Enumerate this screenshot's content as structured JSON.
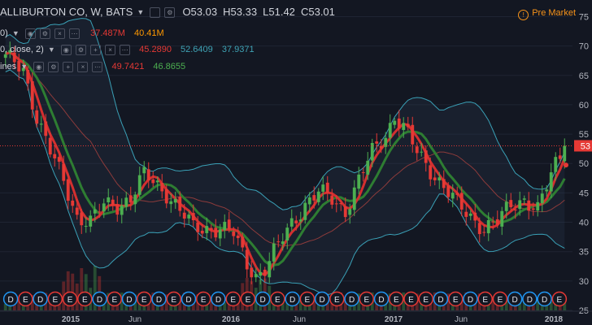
{
  "header": {
    "symbol_title": "ALLIBURTON CO, W, BATS",
    "ohlc": {
      "open": "O53.03",
      "high": "H53.33",
      "low": "L51.42",
      "close": "C53.01"
    },
    "market_status": "Pre Market"
  },
  "indicators": [
    {
      "label": "0)",
      "values": [
        "37.487M",
        "40.41M"
      ]
    },
    {
      "label": "0, close, 2)",
      "values": [
        "45.2890",
        "52.6409",
        "37.9371"
      ]
    },
    {
      "label": "ines",
      "values": [
        "49.7421",
        "46.8655"
      ]
    }
  ],
  "colors": {
    "background": "#131722",
    "up": "#4caf50",
    "down": "#e53935",
    "grid": "#1f2433",
    "band": "#3aa0b6",
    "fast_line": "#d32f2f",
    "slow_line": "#2e7d32",
    "price_line": "#e53935"
  },
  "chart_data": {
    "type": "candlestick",
    "price_axis_ticks": [
      "75",
      "70",
      "65",
      "60",
      "55",
      "50",
      "45",
      "40",
      "35",
      "30",
      "25"
    ],
    "ylim": [
      25,
      77
    ],
    "time_axis_labels": [
      "2015",
      "Jun",
      "2016",
      "Jun",
      "2017",
      "Jun",
      "2018"
    ],
    "last_price_label": "53",
    "last_price": 53.01,
    "anchor_points": [
      [
        0,
        68
      ],
      [
        4,
        66
      ],
      [
        7,
        58
      ],
      [
        10,
        52
      ],
      [
        13,
        47
      ],
      [
        16,
        41
      ],
      [
        19,
        40
      ],
      [
        22,
        43
      ],
      [
        25,
        43
      ],
      [
        28,
        44
      ],
      [
        31,
        48
      ],
      [
        33,
        47
      ],
      [
        36,
        45
      ],
      [
        39,
        42
      ],
      [
        42,
        39
      ],
      [
        45,
        39
      ],
      [
        48,
        39
      ],
      [
        51,
        38
      ],
      [
        54,
        33
      ],
      [
        56,
        31
      ],
      [
        58,
        32
      ],
      [
        61,
        36
      ],
      [
        64,
        40
      ],
      [
        67,
        43
      ],
      [
        70,
        45
      ],
      [
        73,
        44
      ],
      [
        76,
        42
      ],
      [
        79,
        47
      ],
      [
        82,
        52
      ],
      [
        85,
        55
      ],
      [
        87,
        58
      ],
      [
        89,
        56
      ],
      [
        92,
        52
      ],
      [
        95,
        49
      ],
      [
        98,
        46
      ],
      [
        101,
        43
      ],
      [
        104,
        41
      ],
      [
        107,
        39
      ],
      [
        110,
        40
      ],
      [
        113,
        43
      ],
      [
        116,
        44
      ],
      [
        119,
        42
      ],
      [
        121,
        46
      ],
      [
        123,
        50
      ],
      [
        125,
        53
      ]
    ],
    "bar_count": 126,
    "event_markers": [
      "D",
      "E",
      "D",
      "E",
      "E",
      "E",
      "D",
      "E",
      "D",
      "E",
      "D",
      "E",
      "D",
      "E",
      "D",
      "E",
      "E",
      "D",
      "E",
      "D",
      "E",
      "D",
      "E",
      "D",
      "E",
      "D",
      "E",
      "E",
      "E",
      "D",
      "E",
      "D",
      "E",
      "E",
      "D",
      "D",
      "D",
      "E"
    ]
  }
}
